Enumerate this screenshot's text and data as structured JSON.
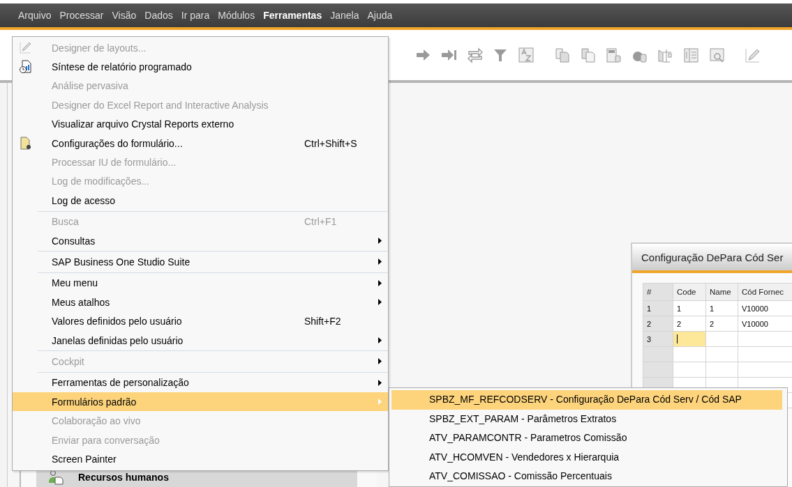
{
  "menu_bar": {
    "items": [
      {
        "label": "Arquivo",
        "selected": false
      },
      {
        "label": "Processar",
        "selected": false
      },
      {
        "label": "Visão",
        "selected": false
      },
      {
        "label": "Dados",
        "selected": false
      },
      {
        "label": "Ir para",
        "selected": false
      },
      {
        "label": "Módulos",
        "selected": false
      },
      {
        "label": "Ferramentas",
        "selected": true
      },
      {
        "label": "Janela",
        "selected": false
      },
      {
        "label": "Ajuda",
        "selected": false
      }
    ]
  },
  "dropdown": {
    "items": [
      {
        "label": "Designer de layouts...",
        "disabled": true,
        "submenu": false,
        "selected": false
      },
      {
        "label": "Síntese de relatório programado",
        "disabled": false,
        "submenu": false,
        "selected": false
      },
      {
        "label": "Análise pervasiva",
        "disabled": true,
        "submenu": false,
        "selected": false
      },
      {
        "label": "Designer do Excel Report and Interactive Analysis",
        "disabled": true,
        "submenu": false,
        "selected": false
      },
      {
        "label": "Visualizar arquivo Crystal Reports externo",
        "disabled": false,
        "submenu": false,
        "selected": false
      },
      {
        "label": "Configurações do formulário...",
        "shortcut": "Ctrl+Shift+S",
        "disabled": false,
        "submenu": false,
        "selected": false
      },
      {
        "label": "Processar IU de formulário...",
        "disabled": true,
        "submenu": false,
        "selected": false
      },
      {
        "label": "Log de modificações...",
        "disabled": true,
        "submenu": false,
        "selected": false
      },
      {
        "label": "Log de acesso",
        "disabled": false,
        "submenu": false,
        "selected": false
      },
      {
        "label": "Busca",
        "shortcut": "Ctrl+F1",
        "disabled": true,
        "submenu": false,
        "selected": false,
        "separator_before": true
      },
      {
        "label": "Consultas",
        "disabled": false,
        "submenu": true,
        "selected": false
      },
      {
        "label": "SAP Business One Studio Suite",
        "disabled": false,
        "submenu": true,
        "selected": false,
        "separator_before": true
      },
      {
        "label": "Meu menu",
        "disabled": false,
        "submenu": true,
        "selected": false,
        "separator_before": true
      },
      {
        "label": "Meus atalhos",
        "disabled": false,
        "submenu": true,
        "selected": false
      },
      {
        "label": "Valores definidos pelo usuário",
        "shortcut": "Shift+F2",
        "disabled": false,
        "submenu": false,
        "selected": false
      },
      {
        "label": "Janelas definidas pelo usuário",
        "disabled": false,
        "submenu": true,
        "selected": false
      },
      {
        "label": "Cockpit",
        "disabled": true,
        "submenu": true,
        "selected": false,
        "separator_before": true
      },
      {
        "label": "Ferramentas de personalização",
        "disabled": false,
        "submenu": true,
        "selected": false,
        "separator_before": true
      },
      {
        "label": "Formulários padrão",
        "disabled": false,
        "submenu": true,
        "selected": true
      },
      {
        "label": "Colaboração ao vivo",
        "disabled": true,
        "submenu": false,
        "selected": false
      },
      {
        "label": "Enviar para conversação",
        "disabled": true,
        "submenu": false,
        "selected": false
      },
      {
        "label": "Screen Painter",
        "disabled": false,
        "submenu": false,
        "selected": false
      }
    ]
  },
  "submenu": {
    "items": [
      {
        "label": "SPBZ_MF_REFCODSERV - Configuração DePara Cód Serv / Cód SAP",
        "selected": true
      },
      {
        "label": "SPBZ_EXT_PARAM - Parâmetros Extratos",
        "selected": false
      },
      {
        "label": "ATV_PARAMCONTR - Parametros Comissão",
        "selected": false
      },
      {
        "label": "ATV_HCOMVEN - Vendedores x Hierarquia",
        "selected": false
      },
      {
        "label": "ATV_COMISSAO - Comissão Percentuais",
        "selected": false
      }
    ]
  },
  "form_window": {
    "title": "Configuração DePara Cód Ser",
    "table": {
      "columns": [
        "#",
        "Code",
        "Name",
        "Cód Fornec"
      ],
      "rows": [
        {
          "number": "1",
          "cells": [
            "1",
            "1",
            "V10000"
          ],
          "focused": false
        },
        {
          "number": "2",
          "cells": [
            "2",
            "2",
            "V10000"
          ],
          "focused": false
        },
        {
          "number": "3",
          "focused": true
        }
      ]
    }
  },
  "side_panel": {
    "item": "Recursos humanos"
  }
}
